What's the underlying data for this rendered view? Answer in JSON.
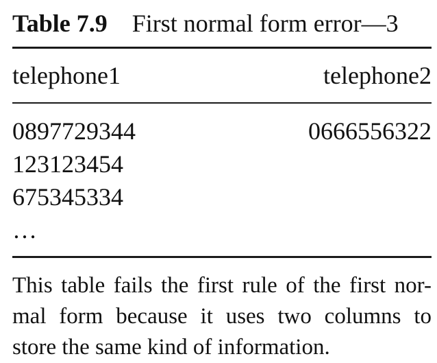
{
  "table": {
    "caption_number": "Table 7.9",
    "caption_title": "First normal form error—3",
    "columns": [
      "telephone1",
      "telephone2"
    ],
    "rows": [
      [
        "0897729344",
        "0666556322"
      ],
      [
        "123123454",
        ""
      ],
      [
        "675345334",
        ""
      ],
      [
        "…",
        ""
      ]
    ]
  },
  "note": {
    "lines": [
      "This table fails the first rule of the first nor-",
      "mal form because it uses two columns to",
      "store the same kind of information."
    ]
  }
}
